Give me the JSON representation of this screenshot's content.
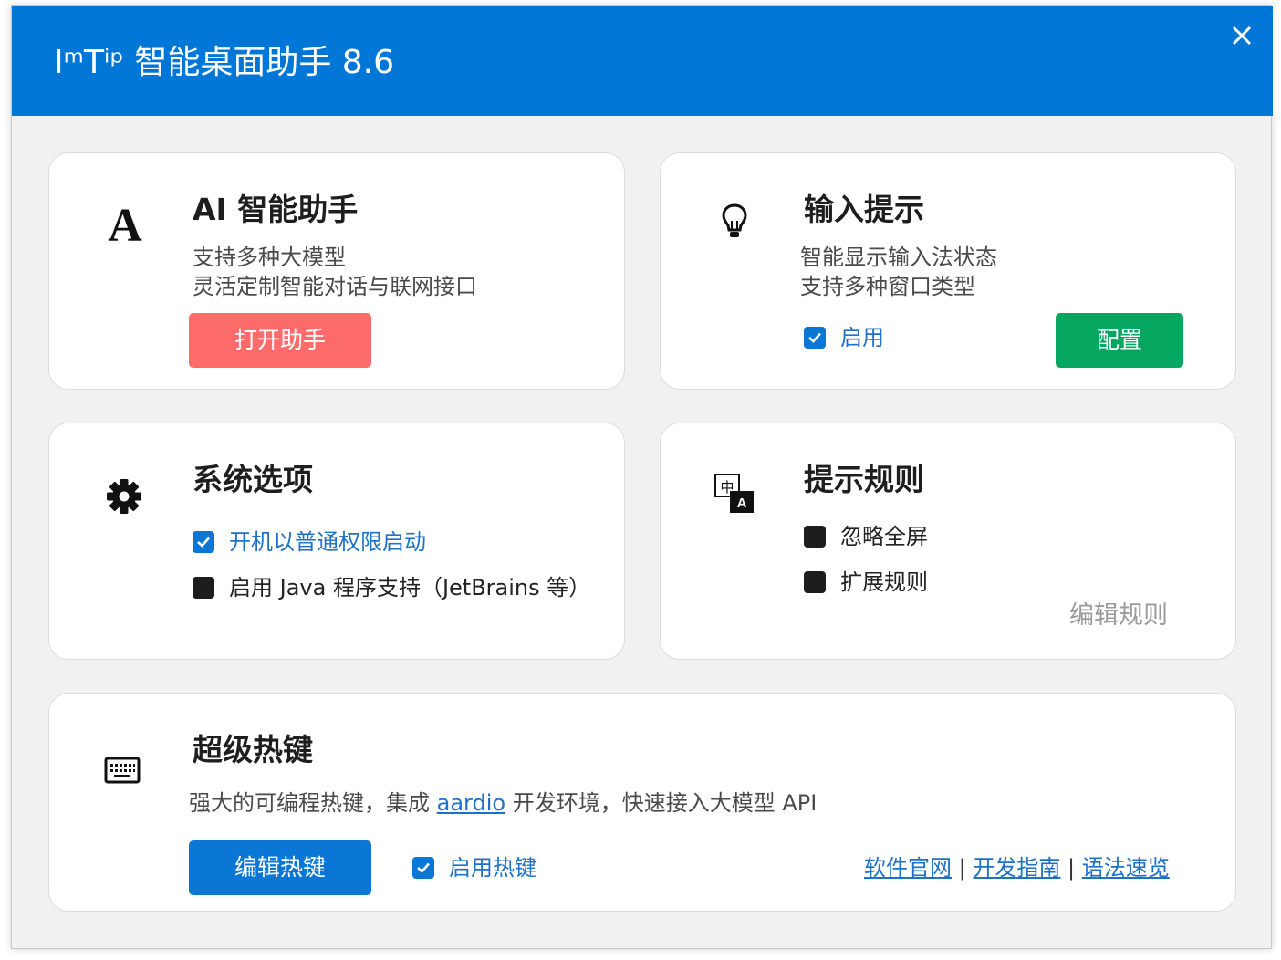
{
  "window": {
    "title": "IᵐTⁱᵖ 智能桌面助手 8.6",
    "close_icon": "close-icon"
  },
  "colors": {
    "titlebar": "#0077d7",
    "open_button": "#fd6c6a",
    "config_button": "#05a660",
    "hotkey_button": "#0a76d6",
    "link": "#1d71c6"
  },
  "cards": {
    "ai": {
      "icon": "letter-a-icon",
      "title": "AI 智能助手",
      "desc1": "支持多种大模型",
      "desc2": "灵活定制智能对话与联网接口",
      "button": "打开助手"
    },
    "input_tip": {
      "icon": "lightbulb-icon",
      "title": "输入提示",
      "desc1": "智能显示输入法状态",
      "desc2": "支持多种窗口类型",
      "enable_label": "启用",
      "enable_checked": true,
      "config_button": "配置"
    },
    "system": {
      "icon": "gear-icon",
      "title": "系统选项",
      "option1_label": "开机以普通权限启动",
      "option1_checked": true,
      "option2_label": "启用 Java 程序支持（JetBrains 等）",
      "option2_checked": false
    },
    "rules": {
      "icon": "translate-icon",
      "title": "提示规则",
      "ignore_fullscreen_label": "忽略全屏",
      "ignore_fullscreen_checked": false,
      "extend_rules_label": "扩展规则",
      "extend_rules_checked": false,
      "edit_link": "编辑规则"
    },
    "hotkey": {
      "icon": "keyboard-icon",
      "title": "超级热键",
      "desc_prefix": "强大的可编程热键，集成 ",
      "desc_link": "aardio",
      "desc_suffix": " 开发环境，快速接入大模型 API",
      "edit_button": "编辑热键",
      "enable_label": "启用热键",
      "enable_checked": true,
      "links": [
        "软件官网",
        "开发指南",
        "语法速览"
      ],
      "separator": "|"
    }
  }
}
